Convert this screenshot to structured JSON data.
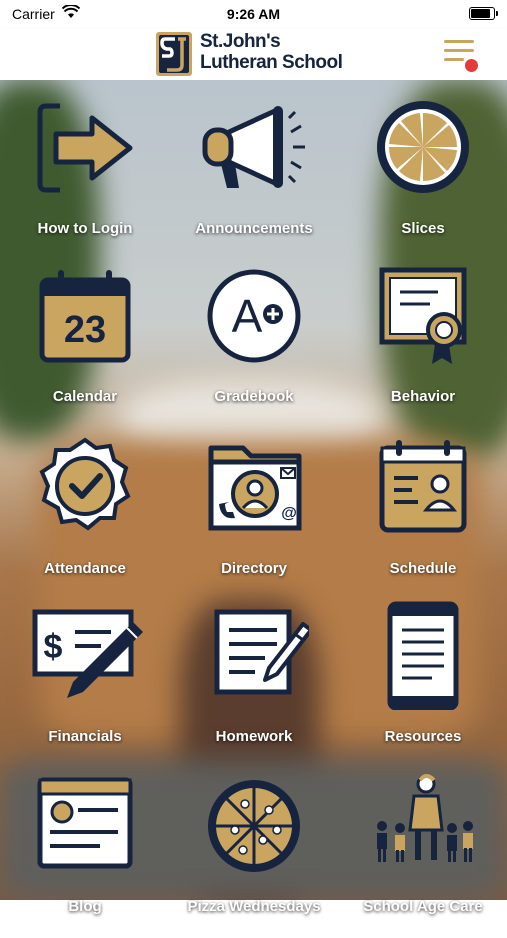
{
  "status_bar": {
    "carrier": "Carrier",
    "time": "9:26 AM"
  },
  "header": {
    "logo_line1": "St.John's",
    "logo_line2": "Lutheran School",
    "logo_monogram": "SJ"
  },
  "colors": {
    "navy": "#16243f",
    "gold": "#c9a560",
    "notification": "#e43a3a"
  },
  "menu": {
    "icon": "hamburger-menu-icon",
    "has_notification": true
  },
  "tiles": [
    {
      "label": "How to Login",
      "icon": "login-arrow-icon"
    },
    {
      "label": "Announcements",
      "icon": "megaphone-icon"
    },
    {
      "label": "Slices",
      "icon": "orange-slice-icon"
    },
    {
      "label": "Calendar",
      "icon": "calendar-icon",
      "calendar_day": "23"
    },
    {
      "label": "Gradebook",
      "icon": "grade-a-plus-icon",
      "grade_text": "A"
    },
    {
      "label": "Behavior",
      "icon": "certificate-icon"
    },
    {
      "label": "Attendance",
      "icon": "checkmark-badge-icon"
    },
    {
      "label": "Directory",
      "icon": "contact-folder-icon"
    },
    {
      "label": "Schedule",
      "icon": "schedule-icon"
    },
    {
      "label": "Financials",
      "icon": "check-writing-icon",
      "currency": "$"
    },
    {
      "label": "Homework",
      "icon": "homework-icon"
    },
    {
      "label": "Resources",
      "icon": "tablet-document-icon"
    },
    {
      "label": "Blog",
      "icon": "blog-icon"
    },
    {
      "label": "Pizza Wednesdays",
      "icon": "pizza-icon"
    },
    {
      "label": "School Age Care",
      "icon": "children-care-icon"
    }
  ]
}
